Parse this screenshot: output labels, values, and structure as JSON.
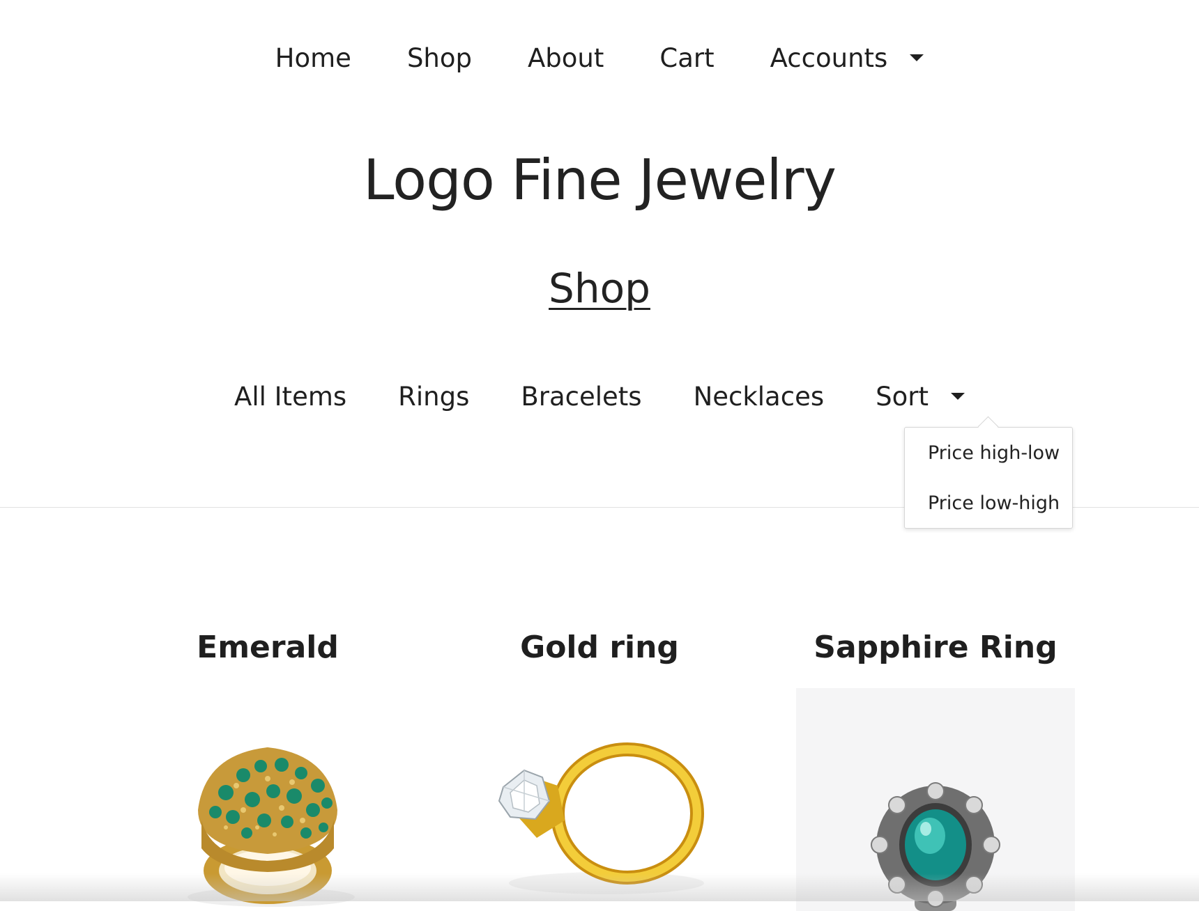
{
  "topnav": {
    "items": [
      {
        "label": "Home"
      },
      {
        "label": "Shop"
      },
      {
        "label": "About"
      },
      {
        "label": "Cart"
      },
      {
        "label": "Accounts",
        "dropdown": true
      }
    ]
  },
  "site_title": "Logo Fine Jewelry",
  "page_heading": "Shop",
  "category_nav": {
    "items": [
      {
        "label": "All Items"
      },
      {
        "label": "Rings"
      },
      {
        "label": "Bracelets"
      },
      {
        "label": "Necklaces"
      },
      {
        "label": "Sort",
        "dropdown": true
      }
    ]
  },
  "sort_menu": {
    "options": [
      {
        "label": "Price high-low"
      },
      {
        "label": "Price low-high"
      }
    ]
  },
  "products": [
    {
      "name": "Emerald",
      "image": "emerald-ring-image"
    },
    {
      "name": "Gold ring",
      "image": "gold-diamond-ring-image"
    },
    {
      "name": "Sapphire Ring",
      "image": "sapphire-ring-image"
    }
  ],
  "colors": {
    "text": "#1f1f1f",
    "gold": "#d9a81e",
    "emerald": "#1a8a6a",
    "teal_gem": "#1aa39a",
    "divider": "#e2e2e2"
  }
}
